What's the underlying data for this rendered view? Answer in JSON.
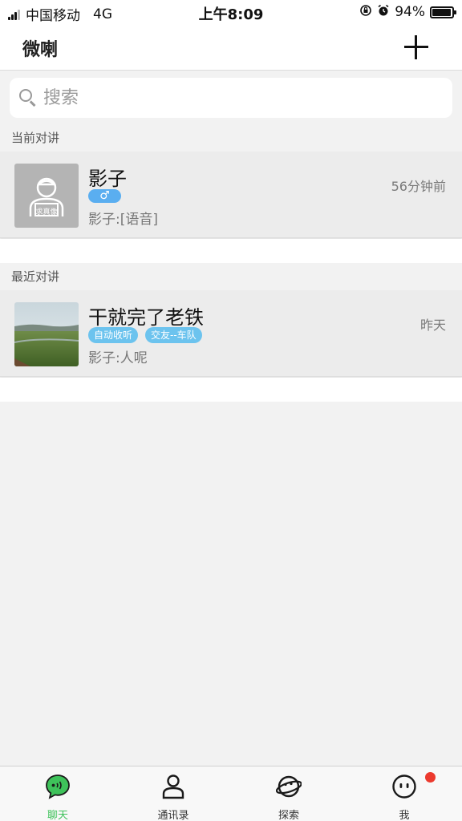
{
  "status_bar": {
    "carrier": "中国移动",
    "network": "4G",
    "time": "上午8:09",
    "battery_text": "94%",
    "battery_level": 0.94
  },
  "header": {
    "title": "微喇",
    "add_icon": "plus-icon"
  },
  "search": {
    "placeholder": "搜索",
    "icon": "search-icon"
  },
  "sections": {
    "current": {
      "title": "当前对讲",
      "chats": [
        {
          "name": "影子",
          "gender": "♂",
          "time": "56分钟前",
          "preview": "影子:[语音]",
          "avatar_label": "求真像"
        }
      ]
    },
    "recent": {
      "title": "最近对讲",
      "chats": [
        {
          "name": "干就完了老铁",
          "tags": [
            "自动收听",
            "交友--车队"
          ],
          "time": "昨天",
          "preview": "影子:人呢"
        }
      ]
    }
  },
  "tabs": [
    {
      "label": "聊天",
      "icon": "chat-bubble-icon",
      "active": true
    },
    {
      "label": "通讯录",
      "icon": "contacts-person-icon",
      "active": false
    },
    {
      "label": "探索",
      "icon": "planet-icon",
      "active": false
    },
    {
      "label": "我",
      "icon": "face-icon",
      "active": false,
      "badge": true
    }
  ],
  "colors": {
    "accent": "#3ec25a",
    "gender_badge": "#5aaef0",
    "tag": "#6cc3ee",
    "notification_dot": "#ec3a2e"
  }
}
